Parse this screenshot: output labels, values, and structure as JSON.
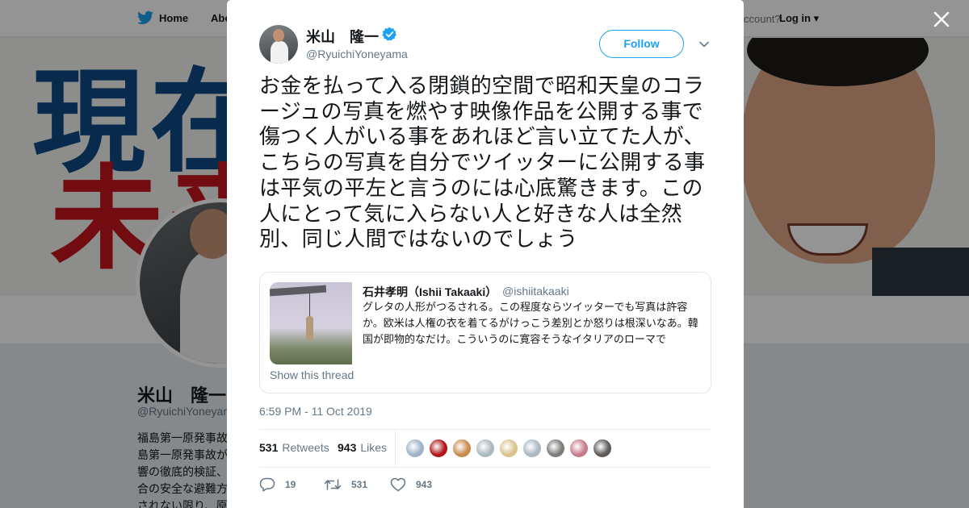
{
  "background": {
    "nav": {
      "home": "Home",
      "about": "Abo",
      "account_prompt": "ccount?",
      "login": "Log in"
    },
    "banner": {
      "line1": "現在",
      "line2": "未来"
    },
    "profile": {
      "name": "米山　隆一",
      "handle": "@RyuichiYoneyam",
      "bio": [
        "福島第一原発事故",
        "島第一原発事故が",
        "響の徹底的検証、",
        "合の安全な避難方",
        "されない限り、原"
      ]
    }
  },
  "modal": {
    "close_icon": "close-icon",
    "author": {
      "name": "米山　隆一",
      "handle": "@RyuichiYoneyama",
      "verified": true
    },
    "follow_label": "Follow",
    "tweet_text": "お金を払って入る閉鎖的空間で昭和天皇のコラージュの写真を燃やす映像作品を公開する事で傷つく人がいる事をあれほど言い立てた人が、こちらの写真を自分でツイッターに公開する事は平気の平左と言うのには心底驚きます。この人にとって気に入らない人と好きな人は全然別、同じ人間ではないのでしょう",
    "quote": {
      "name": "石井孝明（Ishii Takaaki）",
      "handle": "@ishiitakaaki",
      "text": "グレタの人形がつるされる。この程度ならツイッターでも写真は許容か。欧米は人権の衣を着てるがけっこう差別とか怒りは根深いなあ。韓国が即物的なだけ。こういうのに寛容そうなイタリアのローマで",
      "show_thread": "Show this thread"
    },
    "timestamp": "6:59 PM - 11 Oct 2019",
    "stats": {
      "retweets_count": "531",
      "retweets_label": "Retweets",
      "likes_count": "943",
      "likes_label": "Likes"
    },
    "likers_colors": [
      "#9fb3c8",
      "#b2151a",
      "#c98a4d",
      "#aab8c2",
      "#d9c38f",
      "#aab8c2",
      "#7a7d78",
      "#c77b8b",
      "#5d5a58"
    ],
    "actions": {
      "reply_count": "19",
      "retweet_count": "531",
      "like_count": "943"
    },
    "colors": {
      "accent": "#1da1f2",
      "secondary_text": "#657786"
    }
  }
}
